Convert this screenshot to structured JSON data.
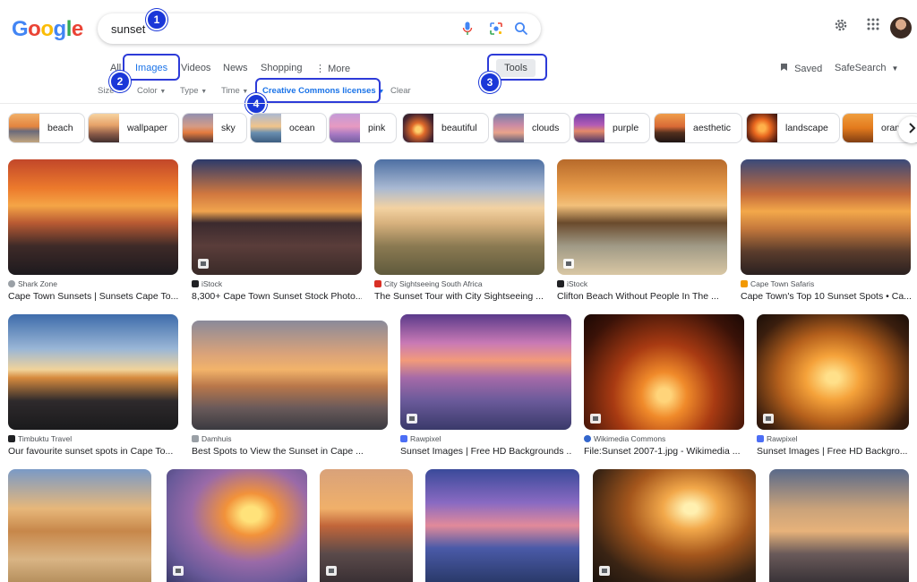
{
  "header": {
    "logo_letters": [
      {
        "ch": "G",
        "color": "#4285f4"
      },
      {
        "ch": "o",
        "color": "#ea4335"
      },
      {
        "ch": "o",
        "color": "#fbbc05"
      },
      {
        "ch": "g",
        "color": "#4285f4"
      },
      {
        "ch": "l",
        "color": "#34a853"
      },
      {
        "ch": "e",
        "color": "#ea4335"
      }
    ],
    "search_query": "sunset",
    "icons": [
      "microphone-icon",
      "lens-icon",
      "search-icon",
      "settings-icon",
      "apps-icon"
    ]
  },
  "tabs": {
    "all": "All",
    "images": "Images",
    "videos": "Videos",
    "news": "News",
    "shopping": "Shopping",
    "more": "More",
    "tools": "Tools",
    "saved": "Saved",
    "safesearch": "SafeSearch"
  },
  "filters": {
    "size": "Size",
    "color": "Color",
    "type": "Type",
    "time": "Time",
    "license": "Creative Commons licenses",
    "clear": "Clear"
  },
  "annotations": [
    "1",
    "2",
    "3",
    "4"
  ],
  "chips": [
    "beach",
    "wallpaper",
    "sky",
    "ocean",
    "pink",
    "beautiful",
    "clouds",
    "purple",
    "aesthetic",
    "landscape",
    "oran"
  ],
  "results": [
    {
      "source": "Shark Zone",
      "title": "Cape Town Sunsets | Sunsets Cape To..."
    },
    {
      "source": "iStock",
      "title": "8,300+ Cape Town Sunset Stock Photo..."
    },
    {
      "source": "City Sightseeing South Africa",
      "title": "The Sunset Tour with City Sightseeing ..."
    },
    {
      "source": "iStock",
      "title": "Clifton Beach Without People In The ..."
    },
    {
      "source": "Cape Town Safaris",
      "title": "Cape Town's Top 10 Sunset Spots • Ca..."
    },
    {
      "source": "Timbuktu Travel",
      "title": "Our favourite sunset spots in Cape To..."
    },
    {
      "source": "Damhuis",
      "title": "Best Spots to View the Sunset in Cape ..."
    },
    {
      "source": "Rawpixel",
      "title": "Sunset Images | Free HD Backgrounds ..."
    },
    {
      "source": "Wikimedia Commons",
      "title": "File:Sunset 2007-1.jpg - Wikimedia ..."
    },
    {
      "source": "Rawpixel",
      "title": "Sunset Images | Free HD Backgro..."
    }
  ],
  "colors": {
    "accent": "#1a73e8",
    "annotation": "#1a37d8"
  }
}
